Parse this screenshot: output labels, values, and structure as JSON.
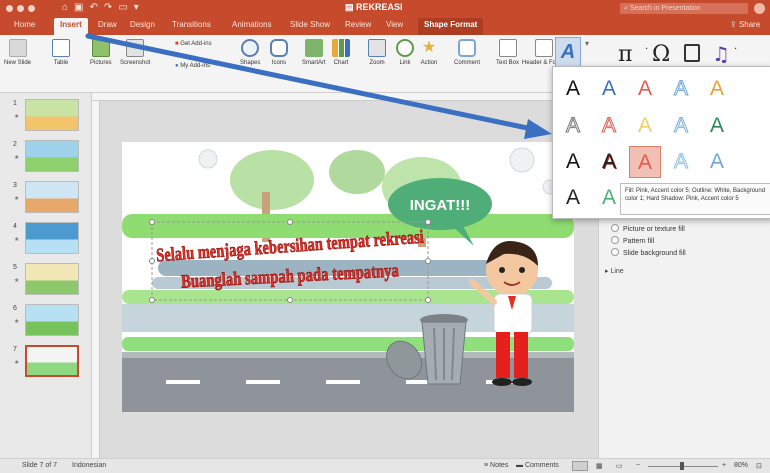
{
  "window": {
    "title": "REKREASI",
    "search_placeholder": "Search in Presentation"
  },
  "tabs": [
    "Home",
    "Insert",
    "Draw",
    "Design",
    "Transitions",
    "Animations",
    "Slide Show",
    "Review",
    "View",
    "Shape Format"
  ],
  "share_label": "Share",
  "ribbon": {
    "new_slide": "New Slide",
    "table": "Table",
    "pictures": "Pictures",
    "screenshot": "Screenshot",
    "get_addins": "Get Add-ins",
    "my_addins": "My Add-ins",
    "shapes": "Shapes",
    "icons": "Icons",
    "smartart": "SmartArt",
    "chart": "Chart",
    "zoom": "Zoom",
    "link": "Link",
    "action": "Action",
    "comment": "Comment",
    "text_box": "Text Box",
    "header_footer": "Header & Footer",
    "equation_glyph": "π",
    "symbol_glyph": "Ω"
  },
  "thumbnails": [
    {
      "num": "1",
      "colors": [
        "#c8e3a4",
        "#f3c46a"
      ]
    },
    {
      "num": "2",
      "colors": [
        "#9ed2ea",
        "#8ed06e"
      ]
    },
    {
      "num": "3",
      "colors": [
        "#cfe7f5",
        "#e8a86a"
      ]
    },
    {
      "num": "4",
      "colors": [
        "#4b9bd1",
        "#b8e0f5"
      ]
    },
    {
      "num": "5",
      "colors": [
        "#f2e7b7",
        "#8ec86c"
      ]
    },
    {
      "num": "6",
      "colors": [
        "#b7e1f3",
        "#78c25b"
      ]
    },
    {
      "num": "7",
      "colors": [
        "#f4f4f4",
        "#8fd882"
      ],
      "selected": true
    }
  ],
  "slide": {
    "bubble_text": "INGAT!!!",
    "line1": "Selalu menjaga kebersihan tempat rekreasi",
    "line2": "Buanglah sampah pada tempatnya"
  },
  "wordart_gallery": {
    "glyph": "A",
    "tooltip": "Fill: Pink, Accent color 5; Outline: White, Background color 1; Hard Shadow: Pink, Accent color 5"
  },
  "format_pane": {
    "options_label": "ptions",
    "picture_fill": "Picture or texture fill",
    "pattern_fill": "Pattern fill",
    "slide_background_fill": "Slide background fill",
    "line_label": "Line"
  },
  "status": {
    "slide_counter": "Slide 7 of 7",
    "language": "Indonesian",
    "notes": "Notes",
    "comments": "Comments",
    "zoom": "80%"
  },
  "colors": {
    "accent": "#c64a2c",
    "pink": "#e6594d",
    "arrow": "#3a6fc1"
  }
}
